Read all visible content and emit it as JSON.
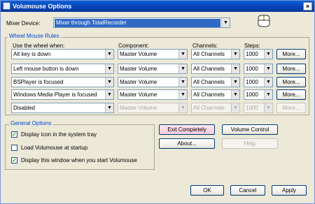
{
  "window": {
    "title": "Volumouse Options",
    "close_label": "×"
  },
  "mixer": {
    "label": "Mixer Device:",
    "value": "Mixer through TotalRecorder"
  },
  "wheel_rules": {
    "title": "Wheel Mouse Rules",
    "headers": {
      "when": "Use the wheel when:",
      "component": "Component:",
      "channels": "Channels:",
      "steps": "Steps:"
    },
    "rows": [
      {
        "when": "Alt key is down",
        "component": "Master Volume",
        "channels": "All Channels",
        "steps": "1000",
        "more": "More...",
        "enabled": true
      },
      {
        "when": "Left mouse button is down",
        "component": "Master Volume",
        "channels": "All Channels",
        "steps": "1000",
        "more": "More...",
        "enabled": true
      },
      {
        "when": "BSPlayer is focused",
        "component": "Master Volume",
        "channels": "All Channels",
        "steps": "1000",
        "more": "More...",
        "enabled": true
      },
      {
        "when": "Windows Media Player is focused",
        "component": "Master Volume",
        "channels": "All Channels",
        "steps": "1000",
        "more": "More...",
        "enabled": true
      },
      {
        "when": "Disabled",
        "component": "Master Volume",
        "channels": "All Channels",
        "steps": "1000",
        "more": "More...",
        "enabled": false
      }
    ]
  },
  "general": {
    "title": "General Options",
    "options": [
      {
        "label": "Display icon in the system tray",
        "checked": true
      },
      {
        "label": "Load Volumouse at startup",
        "checked": false
      },
      {
        "label": "Display this window when you start Volumouse",
        "checked": true
      }
    ]
  },
  "buttons": {
    "exit": "Exit Completely",
    "volume_control": "Volume Control",
    "about": "About...",
    "help": "Help",
    "ok": "OK",
    "cancel": "Cancel",
    "apply": "Apply"
  },
  "icons": {
    "app": "speaker-icon",
    "mouse": "mouse-icon",
    "dropdown": "chevron-down-icon",
    "check": "checkmark-icon"
  }
}
